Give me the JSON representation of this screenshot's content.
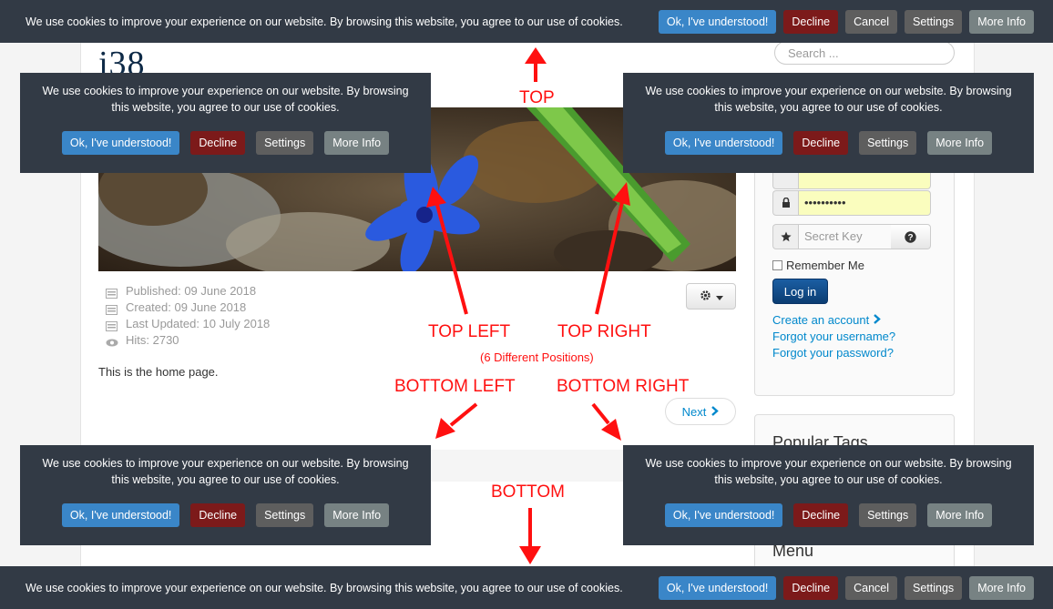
{
  "site": {
    "logo": "j38",
    "search_placeholder": "Search ..."
  },
  "article": {
    "published": "Published: 09 June 2018",
    "created": "Created: 09 June 2018",
    "updated": "Last Updated: 10 July 2018",
    "hits": "Hits: 2730",
    "body": "This is the home page.",
    "next_label": "Next"
  },
  "login": {
    "password_value": "••••••••••",
    "secret_placeholder": "Secret Key",
    "remember_label": "Remember Me",
    "login_button": "Log in",
    "create_account": "Create an account",
    "forgot_username": "Forgot your username?",
    "forgot_password": "Forgot your password?"
  },
  "sidebar": {
    "popular_tags": "Popular Tags",
    "menu": "Menu"
  },
  "cookie": {
    "message": "We use cookies to improve your experience on our website. By browsing this website, you agree to our use of cookies.",
    "message_line1": "We use cookies to improve your experience on our website. By browsing",
    "message_line2": "this website, you agree to our use of cookies.",
    "ok": "Ok, I've understood!",
    "decline": "Decline",
    "cancel": "Cancel",
    "settings": "Settings",
    "more_info": "More Info"
  },
  "annotations": {
    "top": "TOP",
    "top_left": "TOP LEFT",
    "top_right": "TOP RIGHT",
    "positions": "(6 Different Positions)",
    "bottom_left": "BOTTOM LEFT",
    "bottom_right": "BOTTOM RIGHT",
    "bottom": "BOTTOM"
  },
  "colors": {
    "bar_bg": "#323a45",
    "ok": "#3a86c8",
    "decline": "#7c1a1a",
    "neutral": "#5e5e5e",
    "more_info": "#778283",
    "annotation": "#ff1010"
  }
}
